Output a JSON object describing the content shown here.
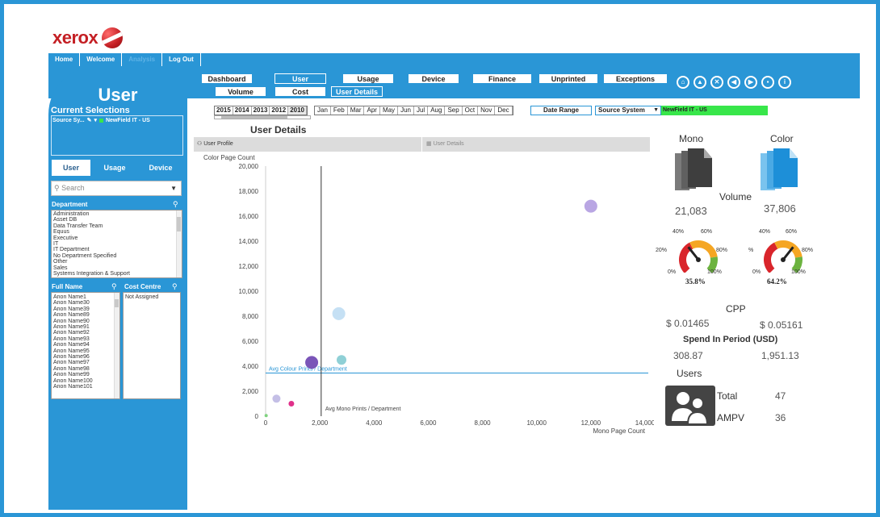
{
  "logo": {
    "text": "xerox"
  },
  "topnav": [
    {
      "label": "Home",
      "dim": false
    },
    {
      "label": "Welcome",
      "dim": false
    },
    {
      "label": "Analysis",
      "dim": true
    },
    {
      "label": "Log Out",
      "dim": false
    }
  ],
  "sidebar": {
    "title": "User",
    "current_selections_label": "Current Selections",
    "selection_field": "Source Sy...",
    "selection_value": "NewField IT - US",
    "tabs": {
      "user": "User",
      "usage": "Usage",
      "device": "Device"
    },
    "search_placeholder": "Search",
    "department_header": "Department",
    "departments": [
      "Administration",
      "Asset DB",
      "Data Transfer Team",
      "Equus",
      "Executive",
      "IT",
      "IT Department",
      "No Department Specified",
      "Other",
      "Sales",
      "Systems Integration & Support"
    ],
    "fullname_header": "Full Name",
    "costcentre_header": "Cost Centre",
    "names": [
      "Anon Name1",
      "Anon Name30",
      "Anon Name39",
      "Anon Name89",
      "Anon Name90",
      "Anon Name91",
      "Anon Name92",
      "Anon Name93",
      "Anon Name94",
      "Anon Name95",
      "Anon Name96",
      "Anon Name97",
      "Anon Name98",
      "Anon Name99",
      "Anon Name100",
      "Anon Name101"
    ],
    "cost_centres": [
      "Not Assigned"
    ]
  },
  "maintabs": [
    {
      "label": "Dashboard",
      "active": false
    },
    {
      "label": "User",
      "active": true
    },
    {
      "label": "Usage",
      "active": false
    },
    {
      "label": "Device",
      "active": false
    },
    {
      "label": "Finance",
      "active": false
    },
    {
      "label": "Unprinted",
      "active": false
    },
    {
      "label": "Exceptions",
      "active": false
    }
  ],
  "subtabs": [
    {
      "label": "Volume",
      "active": false
    },
    {
      "label": "Cost",
      "active": false
    },
    {
      "label": "User Details",
      "active": true
    }
  ],
  "nav_icons": [
    "home-icon",
    "lock-icon",
    "close-icon",
    "back-icon",
    "forward-icon",
    "save-icon",
    "info-icon"
  ],
  "filters": {
    "years": [
      "2015",
      "2014",
      "2013",
      "2012",
      "2010"
    ],
    "selected_year": "2010",
    "months": [
      "Jan",
      "Feb",
      "Mar",
      "Apr",
      "May",
      "Jun",
      "Jul",
      "Aug",
      "Sep",
      "Oct",
      "Nov",
      "Dec"
    ],
    "date_range": "Date Range",
    "source_system_label": "Source System",
    "source_system_value": "NewField IT - US"
  },
  "section_title": "User Details",
  "panel_tabs": {
    "profile": "User Profile",
    "details": "User Details"
  },
  "chart_data": {
    "type": "scatter",
    "ylabel": "Color Page Count",
    "xlabel": "Mono Page Count",
    "xlim": [
      0,
      14000
    ],
    "ylim": [
      0,
      20000
    ],
    "xticks": [
      0,
      2000,
      4000,
      6000,
      8000,
      10000,
      12000,
      14000
    ],
    "yticks": [
      0,
      2000,
      4000,
      6000,
      8000,
      10000,
      12000,
      14000,
      16000,
      18000,
      20000
    ],
    "points": [
      {
        "x": 12000,
        "y": 16800,
        "size": 8,
        "color": "#b9a6e3"
      },
      {
        "x": 2700,
        "y": 8200,
        "size": 8,
        "color": "#c5e0f4"
      },
      {
        "x": 1700,
        "y": 4300,
        "size": 8,
        "color": "#7a55b8"
      },
      {
        "x": 2800,
        "y": 4500,
        "size": 6,
        "color": "#8fd0d6"
      },
      {
        "x": 400,
        "y": 1400,
        "size": 5,
        "color": "#c4bfe6"
      },
      {
        "x": 950,
        "y": 1000,
        "size": 3.5,
        "color": "#e0308a"
      },
      {
        "x": 20,
        "y": 50,
        "size": 2,
        "color": "#7fd27f"
      }
    ],
    "avg_colour": {
      "value": 3450,
      "label": "Avg Colour Prints / Department",
      "color": "#2a96d6"
    },
    "avg_mono": {
      "value": 2050,
      "label": "Avg Mono Prints / Department",
      "color": "#333333"
    }
  },
  "right_panel": {
    "mono_label": "Mono",
    "color_label": "Color",
    "volume_label": "Volume",
    "mono_volume": "21,083",
    "color_volume": "37,806",
    "mono_gauge": {
      "pct_label": "35.8%",
      "value": 0.358,
      "ticks": {
        "t0": "0%",
        "t20": "20%",
        "t40": "40%",
        "t60": "60%",
        "t80": "80%",
        "t100": "100%"
      }
    },
    "color_gauge": {
      "pct_label": "64.2%",
      "value": 0.642,
      "ticks": {
        "t0": "0%",
        "t20": "%",
        "t40": "40%",
        "t60": "60%",
        "t80": "80%",
        "t100": "100%"
      }
    },
    "cpp_label": "CPP",
    "mono_cpp": "$ 0.01465",
    "color_cpp": "$ 0.05161",
    "spend_label": "Spend In Period (USD)",
    "mono_spend": "308.87",
    "color_spend": "1,951.13",
    "users_label": "Users",
    "total_label": "Total",
    "total_value": "47",
    "ampv_label": "AMPV",
    "ampv_value": "36"
  }
}
